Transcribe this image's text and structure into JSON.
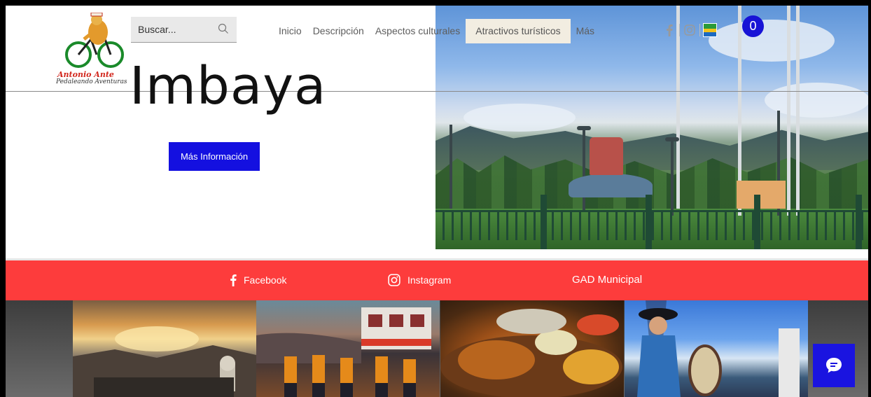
{
  "header": {
    "logo": {
      "line1": "Antonio Ante",
      "line2": "Pedaleando Aventuras"
    },
    "search": {
      "placeholder": "Buscar..."
    },
    "nav": [
      "Inicio",
      "Descripción",
      "Aspectos culturales",
      "Atractivos turísticos",
      "Más"
    ],
    "nav_active_index": 3,
    "social": [
      "facebook-icon",
      "instagram-icon",
      "gad-logo"
    ],
    "cart_count": "0"
  },
  "hero": {
    "title": "Imbaya",
    "cta_label": "Más Información"
  },
  "social_bar": {
    "facebook_label": "Facebook",
    "instagram_label": "Instagram",
    "gad_label": "GAD Municipal"
  },
  "colors": {
    "brand_blue": "#1410e0",
    "bar_red": "#fd3c3c",
    "nav_active_bg": "#f2ede1"
  }
}
